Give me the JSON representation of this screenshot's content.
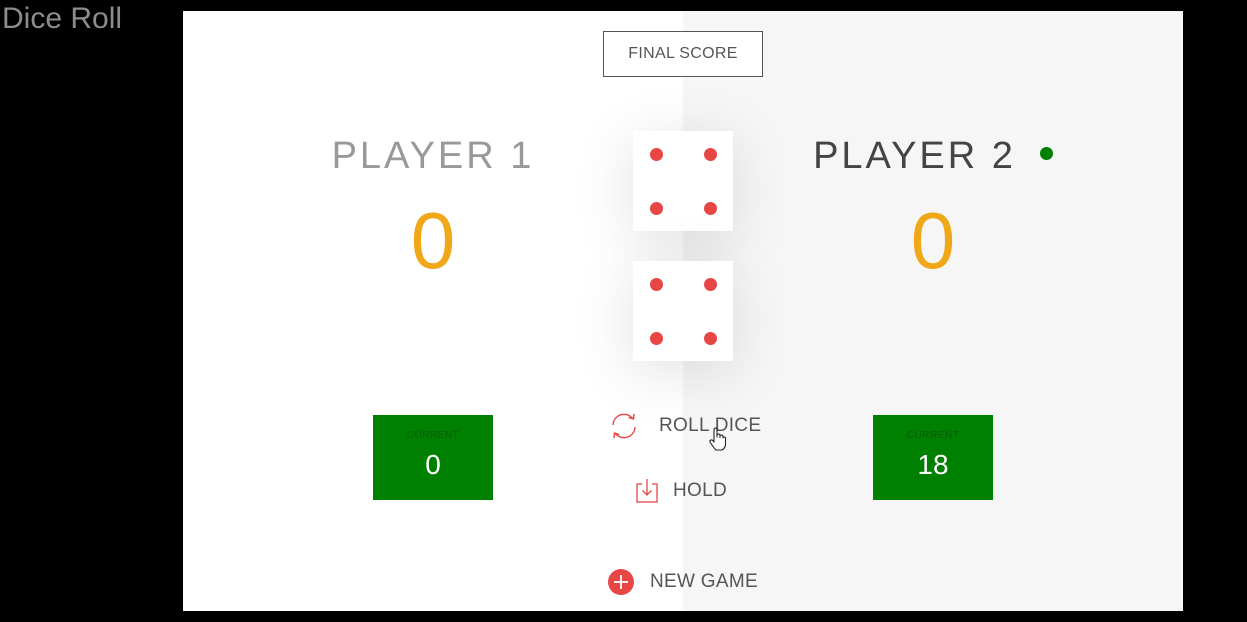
{
  "app": {
    "title": "Dice Roll"
  },
  "final_score": {
    "label": "FINAL SCORE"
  },
  "players": [
    {
      "name": "PLAYER 1",
      "score": "0",
      "current_label": "CURRENT",
      "current": "0",
      "active": false
    },
    {
      "name": "PLAYER 2",
      "score": "0",
      "current_label": "CURRENT",
      "current": "18",
      "active": true
    }
  ],
  "dice": [
    {
      "value": 4
    },
    {
      "value": 4
    }
  ],
  "controls": {
    "roll_label": "ROLL DICE",
    "hold_label": "HOLD",
    "new_game_label": "NEW GAME"
  },
  "colors": {
    "accent": "#e84545",
    "score": "#f0a818",
    "current_bg": "#008000",
    "active_indicator": "#008000"
  },
  "icons": {
    "roll": "refresh-icon",
    "hold": "download-icon",
    "new_game": "plus-circle-icon",
    "active_player": "active-dot-icon"
  }
}
